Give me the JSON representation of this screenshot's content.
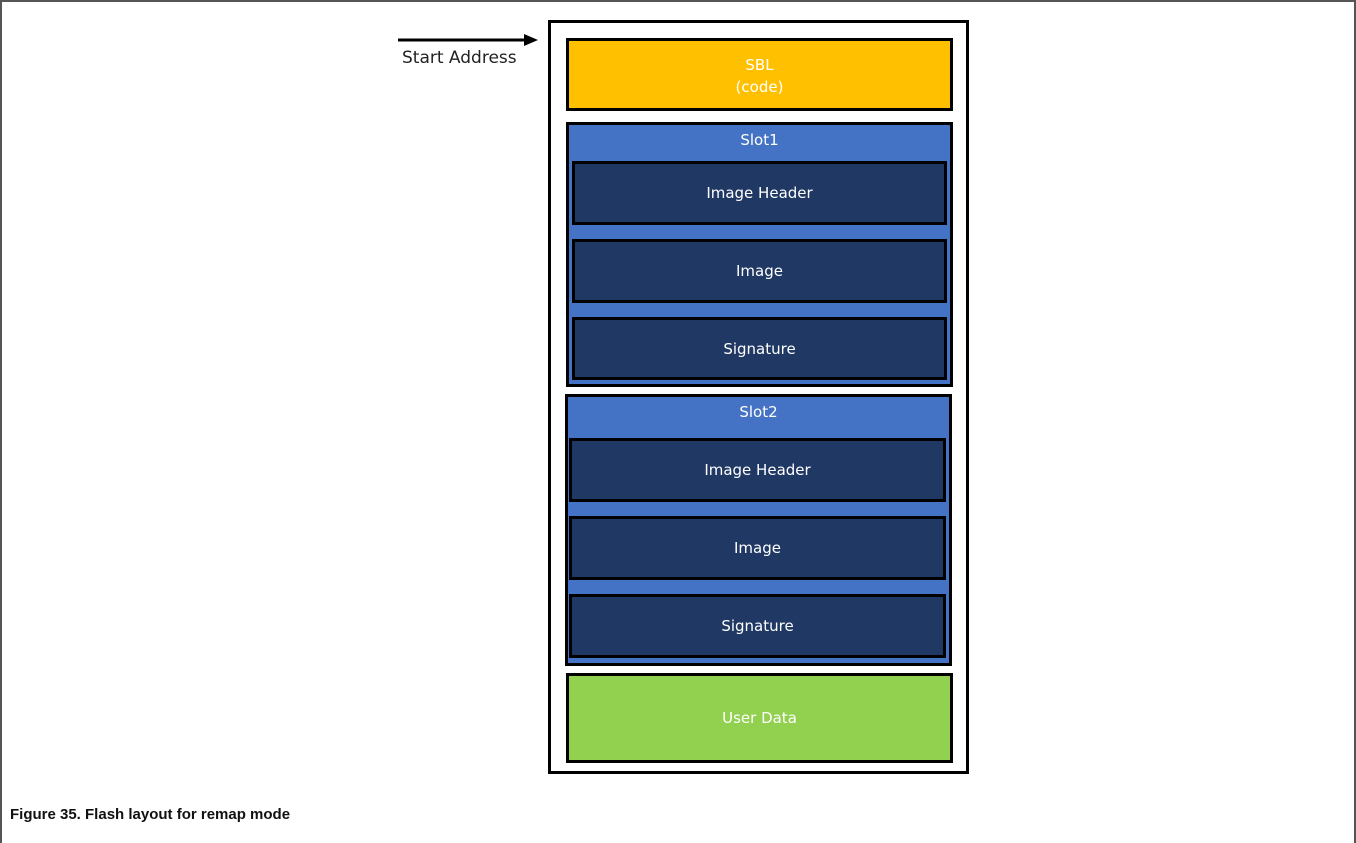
{
  "start_address_label": "Start Address",
  "sbl": {
    "line1": "SBL",
    "line2": "(code)"
  },
  "slot1": {
    "title": "Slot1",
    "items": [
      "Image Header",
      "Image",
      "Signature"
    ]
  },
  "slot2": {
    "title": "Slot2",
    "items": [
      "Image Header",
      "Image",
      "Signature"
    ]
  },
  "user_data": "User Data",
  "caption": "Figure 35. Flash layout for remap mode",
  "colors": {
    "sbl": "#ffc000",
    "slot": "#4472c4",
    "sub_block": "#203864",
    "user_data": "#92d050"
  }
}
